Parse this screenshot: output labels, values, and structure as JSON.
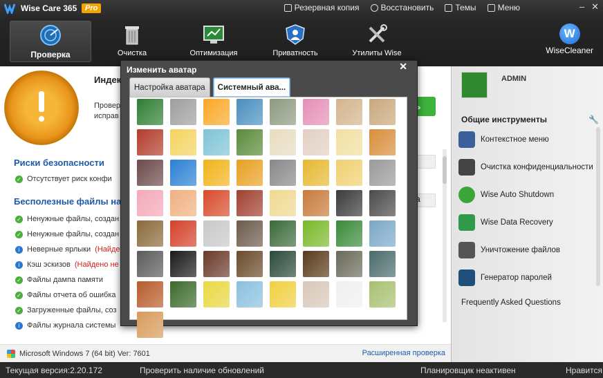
{
  "app": {
    "title": "Wise Care 365",
    "badge": "Pro",
    "menu": [
      {
        "label": "Резервная копия",
        "icon": "backup-icon"
      },
      {
        "label": "Восстановить",
        "icon": "restore-icon"
      },
      {
        "label": "Темы",
        "icon": "themes-icon"
      },
      {
        "label": "Меню",
        "icon": "menu-icon"
      }
    ],
    "window_controls": [
      "–",
      "✕"
    ]
  },
  "tabs": [
    {
      "label": "Проверка",
      "icon": "radar-icon",
      "active": true
    },
    {
      "label": "Очистка",
      "icon": "trash-icon",
      "active": false
    },
    {
      "label": "Оптимизация",
      "icon": "optimize-icon",
      "active": false
    },
    {
      "label": "Приватность",
      "icon": "shield-icon",
      "active": false
    },
    {
      "label": "Утилиты Wise",
      "icon": "tools-icon",
      "active": false
    }
  ],
  "brand": {
    "logo_letter": "W",
    "name": "WiseCleaner"
  },
  "main": {
    "index_title": "Индек",
    "check_text_1": "Провер",
    "check_text_2": "исправ",
    "fix_button": "ть",
    "section_risks": "Риски безопасности",
    "section_junk": "Бесполезные файлы на",
    "rows": [
      {
        "status": "ok",
        "text": "Отсутствует риск конфи",
        "extra": ""
      },
      {
        "status": "ok",
        "text": "Ненужные файлы, создан",
        "extra": ""
      },
      {
        "status": "ok",
        "text": "Ненужные файлы, создан",
        "extra": ""
      },
      {
        "status": "info",
        "text": "Неверные ярлыки ",
        "extra": "(Найде"
      },
      {
        "status": "info",
        "text": "Кэш эскизов ",
        "extra": "(Найдено не"
      },
      {
        "status": "ok",
        "text": "Файлы дампа памяти",
        "extra": ""
      },
      {
        "status": "ok",
        "text": "Файлы отчета об ошибка",
        "extra": ""
      },
      {
        "status": "ok",
        "text": "Загруженные файлы, соз",
        "extra": ""
      },
      {
        "status": "info",
        "text": "Файлы журнала системы",
        "extra": ""
      }
    ],
    "mid_button": "а",
    "system_info": "Microsoft Windows 7 (64 bit) Ver: 7601",
    "advanced_check": "Расширенная проверка"
  },
  "right": {
    "user": "ADMIN",
    "tools_title": "Общие инструменты",
    "tools": [
      {
        "label": "Контекстное меню",
        "icon": "context-menu-icon",
        "color": "#3a5f9a"
      },
      {
        "label": "Очистка конфиденциальности",
        "icon": "glasses-icon",
        "color": "#444444"
      },
      {
        "label": "Wise Auto Shutdown",
        "icon": "clock-icon",
        "color": "#3aa63a"
      },
      {
        "label": "Wise Data Recovery",
        "icon": "recovery-icon",
        "color": "#2e9a4a"
      },
      {
        "label": "Уничтожение файлов",
        "icon": "shredder-icon",
        "color": "#555555"
      },
      {
        "label": "Генератор паролей",
        "icon": "key-icon",
        "color": "#1e4f7a"
      }
    ],
    "faq": "Frequently Asked Questions"
  },
  "status": {
    "version": "Текущая версия:2.20.172",
    "updates": "Проверить наличие обновлений",
    "scheduler": "Планировщик неактивен",
    "like": "Нравится"
  },
  "dialog": {
    "title": "Изменить аватар",
    "close": "✕",
    "tabs": [
      {
        "label": "Настройка аватара",
        "selected": false
      },
      {
        "label": "Системный ава...",
        "selected": true
      }
    ],
    "avatars": [
      {
        "name": "pirate-avatar",
        "color": "#2e7d32"
      },
      {
        "name": "temple-avatar",
        "color": "#9e9e9e"
      },
      {
        "name": "flower-avatar",
        "color": "#f9a825"
      },
      {
        "name": "landscape-avatar",
        "color": "#4a8fbf"
      },
      {
        "name": "clouds-avatar",
        "color": "#8e9a80"
      },
      {
        "name": "dahlia-avatar",
        "color": "#e58fb6"
      },
      {
        "name": "pots-avatar",
        "color": "#d4b48c"
      },
      {
        "name": "cake-avatar",
        "color": "#c9a87c"
      },
      {
        "name": "tea-avatar",
        "color": "#b23b2a"
      },
      {
        "name": "lemon-avatar",
        "color": "#f4d35e"
      },
      {
        "name": "chair-avatar",
        "color": "#7ec3d6"
      },
      {
        "name": "snowdrop-avatar",
        "color": "#5a8a3a"
      },
      {
        "name": "sunhat-avatar",
        "color": "#e8dcc0"
      },
      {
        "name": "mouse-avatar",
        "color": "#e2cfc3"
      },
      {
        "name": "duck-avatar",
        "color": "#f0e0a0"
      },
      {
        "name": "puppy-avatar",
        "color": "#d98d3a"
      },
      {
        "name": "vulture-avatar",
        "color": "#6b4a4a"
      },
      {
        "name": "penguin-avatar",
        "color": "#2a7fd4"
      },
      {
        "name": "giraffe-avatar",
        "color": "#f2b31a"
      },
      {
        "name": "lion-cartoon-avatar",
        "color": "#e8a020"
      },
      {
        "name": "zebra-avatar",
        "color": "#888888"
      },
      {
        "name": "lion-avatar",
        "color": "#e6b830"
      },
      {
        "name": "cat-cartoon-avatar",
        "color": "#f0d070"
      },
      {
        "name": "elephant-avatar",
        "color": "#9a9a9a"
      },
      {
        "name": "pig-avatar",
        "color": "#f4a8b8"
      },
      {
        "name": "boy-avatar",
        "color": "#f0b080"
      },
      {
        "name": "redhead-girl-avatar",
        "color": "#d84a2a"
      },
      {
        "name": "brunette-avatar",
        "color": "#a04030"
      },
      {
        "name": "blonde-avatar",
        "color": "#f0d890"
      },
      {
        "name": "girl-avatar",
        "color": "#c87a3a"
      },
      {
        "name": "man-avatar",
        "color": "#3a3a3a"
      },
      {
        "name": "bearded-man-avatar",
        "color": "#4a4a4a"
      },
      {
        "name": "lemur-avatar",
        "color": "#8a6a3a"
      },
      {
        "name": "frog-avatar",
        "color": "#d4402a"
      },
      {
        "name": "bulldog-avatar",
        "color": "#c8c8c8"
      },
      {
        "name": "horse-avatar",
        "color": "#6a5a4a"
      },
      {
        "name": "panda-avatar",
        "color": "#3a6a3a"
      },
      {
        "name": "chameleon-avatar",
        "color": "#7ab82a"
      },
      {
        "name": "parrots-avatar",
        "color": "#3a8a3a"
      },
      {
        "name": "swan-avatar",
        "color": "#7aa8c8"
      },
      {
        "name": "robot-dog-avatar",
        "color": "#5a5a5a"
      },
      {
        "name": "space-avatar",
        "color": "#1a1a1a"
      },
      {
        "name": "fractal-avatar",
        "color": "#6a3a2a"
      },
      {
        "name": "sculpture-avatar",
        "color": "#6a4a2a"
      },
      {
        "name": "ufo-avatar",
        "color": "#2a4a3a"
      },
      {
        "name": "planet-avatar",
        "color": "#5a3a1a"
      },
      {
        "name": "hands-avatar",
        "color": "#6a6a5a"
      },
      {
        "name": "android-avatar",
        "color": "#4a6a6a"
      },
      {
        "name": "canyon-avatar",
        "color": "#b85a2a"
      },
      {
        "name": "ribbons-avatar",
        "color": "#3a6a2a"
      },
      {
        "name": "cactus-avatar",
        "color": "#e8d840"
      },
      {
        "name": "jellyfish-avatar",
        "color": "#8ac0e0"
      },
      {
        "name": "submarine-avatar",
        "color": "#f0d040"
      },
      {
        "name": "kitten-avatar",
        "color": "#d8c8b8"
      },
      {
        "name": "spider-avatar",
        "color": "#f0f0f0"
      },
      {
        "name": "dandelion-avatar",
        "color": "#a8c070"
      },
      {
        "name": "shell-avatar",
        "color": "#d89a5a"
      }
    ]
  }
}
